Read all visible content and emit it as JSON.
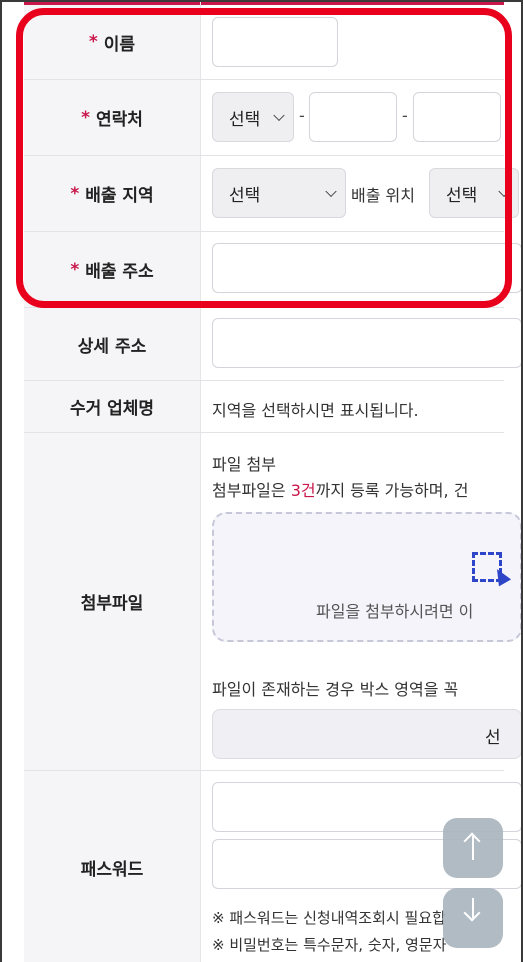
{
  "form": {
    "name": {
      "label": "이름",
      "required_mark": "*"
    },
    "contact": {
      "label": "연락처",
      "required_mark": "*",
      "prefix_select": "선택",
      "dash1": "-",
      "dash2": "-"
    },
    "region": {
      "label": "배출 지역",
      "required_mark": "*",
      "select_value": "선택",
      "position_label": "배출 위치",
      "position_select": "선택"
    },
    "address": {
      "label": "배출 주소",
      "required_mark": "*"
    },
    "detail_address": {
      "label": "상세 주소"
    },
    "company": {
      "label": "수거 업체명",
      "value": "지역을 선택하시면 표시됩니다."
    },
    "attachment": {
      "label": "첨부파일",
      "title": "파일 첨부",
      "desc_before": "첨부파일은 ",
      "desc_highlight": "3건",
      "desc_after": "까지 등록 가능하며, 건",
      "dropzone_text": "파일을 첨부하시려면 이",
      "notice": "파일이 존재하는 경우 박스 영역을 꼭 ",
      "select_button": "선"
    },
    "password": {
      "label": "패스워드",
      "note1": "※ 패스워드는 신청내역조회시 필요합",
      "note2": "※ 비밀번호는 특수문자, 숫자, 영문자"
    }
  },
  "colors": {
    "accent": "#c8174b",
    "highlight": "#e8001c",
    "upload_icon": "#2f45c8"
  },
  "icons": {
    "scroll_up": "arrow-up-icon",
    "scroll_down": "arrow-down-icon",
    "upload": "upload-image-icon",
    "select": "chevron-down-icon"
  }
}
